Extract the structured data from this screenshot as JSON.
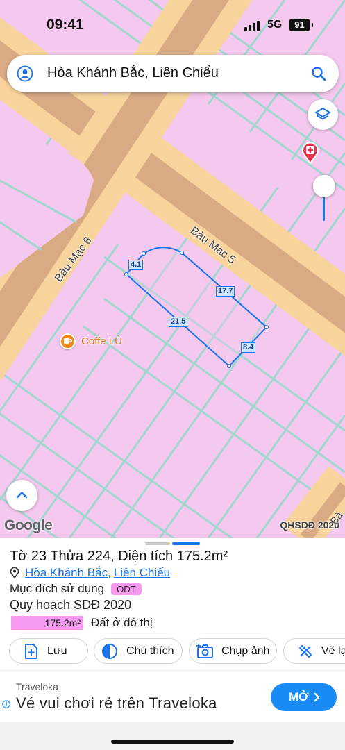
{
  "status_bar": {
    "time": "09:41",
    "network": "5G",
    "battery": "91"
  },
  "search": {
    "query": "Hòa Khánh Bắc, Liên Chiểu"
  },
  "map": {
    "streets": [
      "Bàu Mạc 6",
      "Bàu Mạc 5"
    ],
    "poi": {
      "name": "Coffe LÙ"
    },
    "parcel_dimensions": [
      "4.1",
      "17.7",
      "21.5",
      "8.4"
    ],
    "google_logo": "Google",
    "overlay_label": "QHSDĐ 2020",
    "edge_label": "Bà",
    "colors": {
      "land": "#f5c9ef",
      "road": "#f8d39c",
      "road_center": "#d9ab85",
      "parcel_lines": "#9fd7cf",
      "parcel_outline": "#1a73e8"
    }
  },
  "panel": {
    "title": "Tờ 23 Thửa 224, Diện tích 175.2m²",
    "address": {
      "ward": "Hòa Khánh Bắc",
      "separator": ",",
      "district": "Liên Chiểu"
    },
    "purpose_label": "Mục đích sử dụng",
    "purpose_badge": "ODT",
    "plan_label": "Quy hoạch SDĐ 2020",
    "area_value": "175.2m²",
    "area_desc": "Đất ở đô thị",
    "actions": [
      {
        "label": "Lưu",
        "icon": "save-plus-icon"
      },
      {
        "label": "Chú thích",
        "icon": "contrast-icon"
      },
      {
        "label": "Chụp ảnh",
        "icon": "camera-icon"
      },
      {
        "label": "Vẽ lạ",
        "icon": "draw-icon"
      }
    ]
  },
  "ad": {
    "brand": "Traveloka",
    "headline": "Vé vui chơi rẻ trên Traveloka",
    "cta": "MỞ"
  }
}
